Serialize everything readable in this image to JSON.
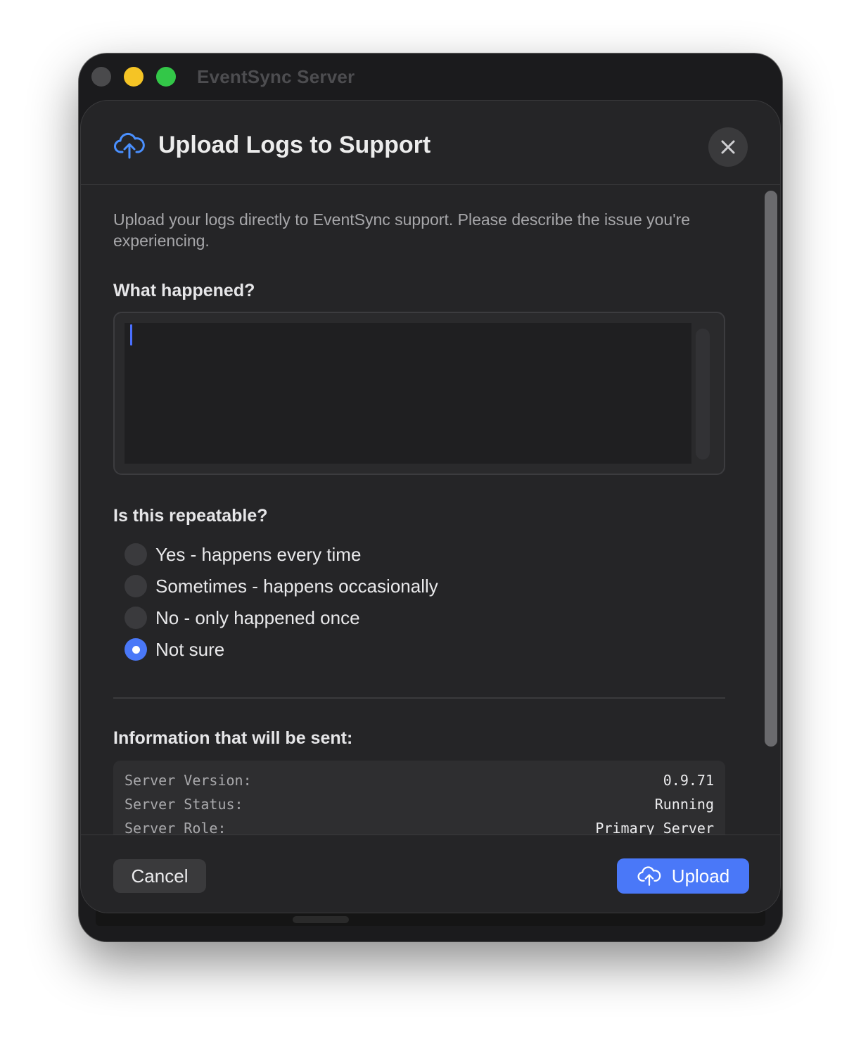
{
  "window": {
    "title": "EventSync Server"
  },
  "dialog": {
    "title": "Upload Logs to Support",
    "header_icon": "cloud-upload-icon",
    "close_icon": "close-icon",
    "intro": "Upload your logs directly to EventSync support. Please describe the issue you're experiencing.",
    "what_happened_label": "What happened?",
    "what_happened_value": "",
    "repeatable_label": "Is this repeatable?",
    "repeatable_options": [
      {
        "label": "Yes - happens every time",
        "selected": false
      },
      {
        "label": "Sometimes - happens occasionally",
        "selected": false
      },
      {
        "label": "No - only happened once",
        "selected": false
      },
      {
        "label": "Not sure",
        "selected": true
      }
    ],
    "info_label": "Information that will be sent:",
    "info_rows": [
      {
        "key": "Server Version:",
        "value": "0.9.71"
      },
      {
        "key": "Server Status:",
        "value": "Running"
      },
      {
        "key": "Server Role:",
        "value": "Primary Server"
      }
    ],
    "cancel_label": "Cancel",
    "upload_label": "Upload",
    "accent_color": "#4a78f8"
  }
}
